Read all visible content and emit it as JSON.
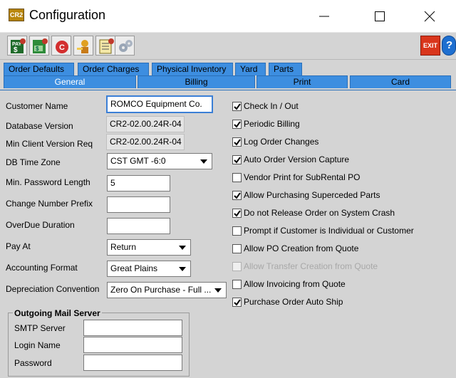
{
  "window": {
    "title": "Configuration",
    "app_icon_text": "CR2"
  },
  "toolbar": {
    "buttons": [
      "pay-icon",
      "invoice-icon",
      "cancel-icon",
      "key-user-icon",
      "notes-icon",
      "settings-gears-icon"
    ],
    "exit_label": "EXIT"
  },
  "tabs": {
    "top": [
      "Order Defaults",
      "Order  Charges",
      "Physical Inventory",
      "Yard",
      "Parts"
    ],
    "bottom": [
      "General",
      "Billing",
      "Print",
      "Card"
    ],
    "active": "General"
  },
  "form": {
    "customer_name": {
      "label": "Customer Name",
      "value": "ROMCO Equipment Co."
    },
    "database_version": {
      "label": "Database Version",
      "value": "CR2-02.00.24R-04"
    },
    "min_client_version": {
      "label": "Min Client Version Req",
      "value": "CR2-02.00.24R-04"
    },
    "db_time_zone": {
      "label": "DB Time Zone",
      "value": "CST GMT -6:0"
    },
    "min_password_length": {
      "label": "Min. Password Length",
      "value": "5"
    },
    "change_number_prefix": {
      "label": "Change Number Prefix",
      "value": ""
    },
    "overdue_duration": {
      "label": "OverDue Duration",
      "value": ""
    },
    "pay_at": {
      "label": "Pay At",
      "value": "Return"
    },
    "accounting_format": {
      "label": "Accounting Format",
      "value": "Great Plains"
    },
    "depreciation_convention": {
      "label": "Depreciation Convention",
      "value": "Zero On Purchase - Full ..."
    }
  },
  "mail": {
    "title": "Outgoing Mail Server",
    "smtp_label": "SMTP Server",
    "login_label": "Login Name",
    "password_label": "Password",
    "smtp_value": "",
    "login_value": "",
    "password_value": ""
  },
  "checkboxes": [
    {
      "label": "Check In / Out",
      "checked": true,
      "enabled": true
    },
    {
      "label": "Periodic Billing",
      "checked": true,
      "enabled": true
    },
    {
      "label": "Log Order Changes",
      "checked": true,
      "enabled": true
    },
    {
      "label": "Auto Order Version Capture",
      "checked": true,
      "enabled": true
    },
    {
      "label": "Vendor Print for SubRental PO",
      "checked": false,
      "enabled": true
    },
    {
      "label": "Allow Purchasing Superceded Parts",
      "checked": true,
      "enabled": true
    },
    {
      "label": "Do not Release Order on System Crash",
      "checked": true,
      "enabled": true
    },
    {
      "label": "Prompt if Customer is Individual or Customer",
      "checked": false,
      "enabled": true
    },
    {
      "label": "Allow PO Creation from Quote",
      "checked": false,
      "enabled": true
    },
    {
      "label": "Allow Transfer Creation from Quote",
      "checked": false,
      "enabled": false
    },
    {
      "label": "Allow Invoicing from Quote",
      "checked": false,
      "enabled": true
    },
    {
      "label": "Purchase Order Auto Ship",
      "checked": true,
      "enabled": true
    }
  ],
  "colors": {
    "tab_blue": "#3d8ee0",
    "panel_gray": "#d4d4d4",
    "exit_red": "#d9361c"
  }
}
